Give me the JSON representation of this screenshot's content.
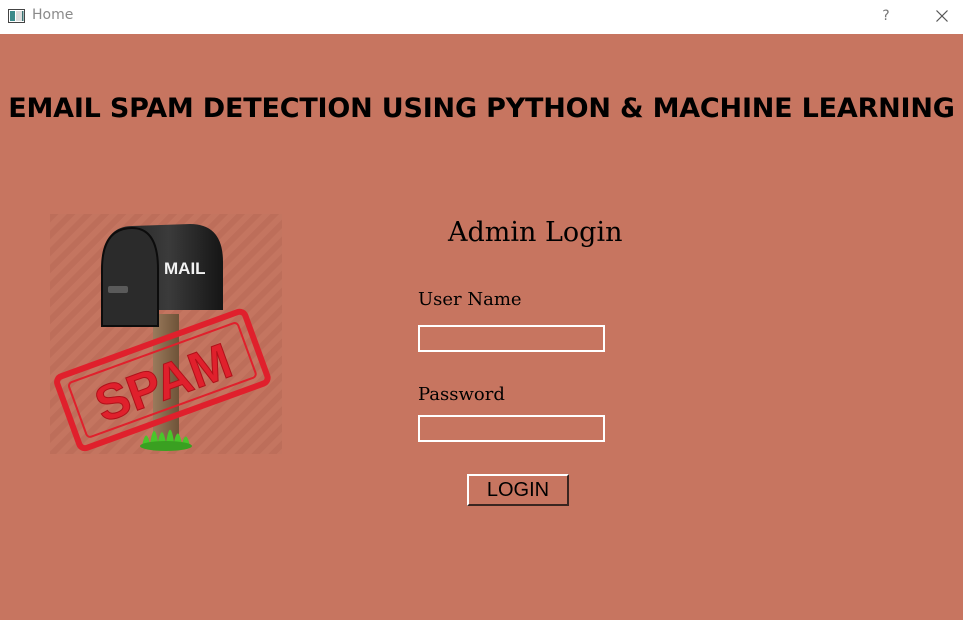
{
  "window": {
    "title": "Home",
    "help_label": "?"
  },
  "header": {
    "title": "EMAIL SPAM DETECTION USING PYTHON & MACHINE LEARNING"
  },
  "illustration": {
    "mailbox_text": "MAIL",
    "stamp_text": "SPAM"
  },
  "login": {
    "title": "Admin Login",
    "username_label": "User Name",
    "username_value": "",
    "password_label": "Password",
    "password_value": "",
    "button_label": "LOGIN"
  },
  "colors": {
    "background": "#c77560",
    "stamp": "#e0202c",
    "field_border": "#ffffff"
  }
}
